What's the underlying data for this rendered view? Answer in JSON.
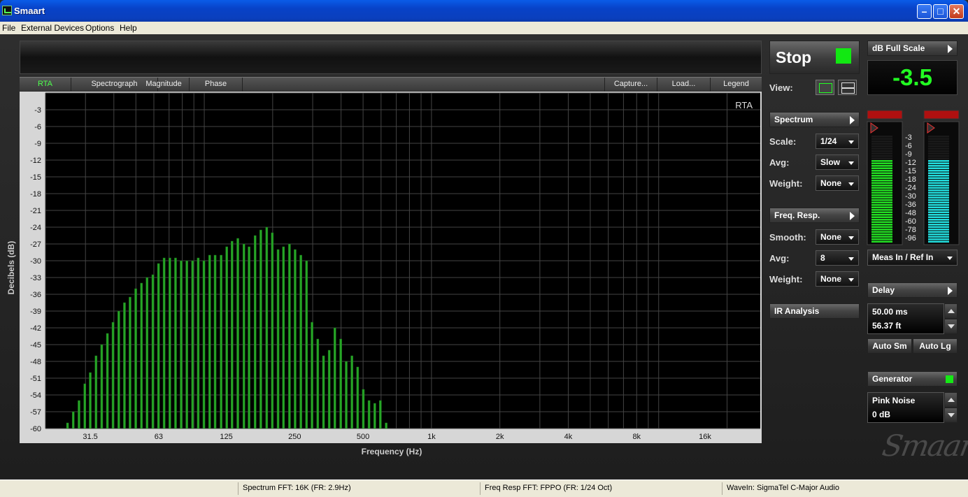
{
  "window": {
    "title": "Smaart"
  },
  "menu": [
    "File",
    "External Devices",
    "Options",
    "Help"
  ],
  "tabs": {
    "left": [
      "RTA",
      "Spectrograph",
      "Magnitude",
      "Phase"
    ],
    "right": [
      "Capture...",
      "Load...",
      "Legend"
    ],
    "active": "RTA"
  },
  "chart_data": {
    "type": "bar",
    "title": "RTA",
    "xlabel": "Frequency (Hz)",
    "ylabel": "Decibels (dB)",
    "x_scale": "log",
    "xlim": [
      20,
      28000
    ],
    "ylim": [
      -60,
      0
    ],
    "grid": true,
    "x_ticks": [
      "31.5",
      "63",
      "125",
      "250",
      "500",
      "1k",
      "2k",
      "4k",
      "8k",
      "16k"
    ],
    "y_ticks": [
      "-3",
      "-6",
      "-9",
      "-12",
      "-15",
      "-18",
      "-21",
      "-24",
      "-27",
      "-30",
      "-33",
      "-36",
      "-39",
      "-42",
      "-45",
      "-48",
      "-51",
      "-54",
      "-57",
      "-60"
    ],
    "bar_color": "#26a626",
    "series": [
      {
        "frequency_hz": [
          23.7,
          25.1,
          26.6,
          28.2,
          29.9,
          31.6,
          33.5,
          35.5,
          37.6,
          39.8,
          42.2,
          44.7,
          47.3,
          50.1,
          53.1,
          56.2,
          59.6,
          63.1,
          66.8,
          70.8,
          75.0,
          79.4,
          84.1,
          89.1,
          94.4,
          100,
          106,
          112,
          119,
          126,
          133,
          141,
          150,
          158,
          168,
          178,
          189,
          200,
          212,
          224,
          238,
          252,
          267,
          283,
          299,
          317,
          336,
          356,
          377,
          400,
          423,
          448,
          475,
          503,
          533,
          565,
          598,
          634
        ],
        "level_db": [
          -60,
          -59,
          -57,
          -55,
          -52,
          -50,
          -47,
          -45,
          -43,
          -41,
          -39,
          -37.5,
          -36.5,
          -35,
          -34,
          -33,
          -32.5,
          -30.5,
          -29.5,
          -29.5,
          -29.5,
          -30,
          -30,
          -30,
          -29.5,
          -30,
          -29,
          -29,
          -29,
          -27.5,
          -26.5,
          -26,
          -27,
          -27.5,
          -25.5,
          -24.5,
          -24,
          -25,
          -28,
          -27.5,
          -27,
          -28,
          -29,
          -30,
          -41,
          -44,
          -47,
          -46,
          -42,
          -44,
          -48,
          -47,
          -49,
          -53,
          -55,
          -55.5,
          -55,
          -59
        ]
      }
    ]
  },
  "controls": {
    "stop_label": "Stop",
    "view_label": "View:",
    "dbfs_header": "dB Full Scale",
    "dbfs_value": "-3.5",
    "spectrum_header": "Spectrum",
    "scale_label": "Scale:",
    "scale_value": "1/24",
    "avg_label": "Avg:",
    "avg_value": "Slow",
    "weight_label": "Weight:",
    "weight_value": "None",
    "freqresp_header": "Freq. Resp.",
    "smooth_label": "Smooth:",
    "smooth_value": "None",
    "fr_avg_label": "Avg:",
    "fr_avg_value": "8",
    "fr_weight_label": "Weight:",
    "fr_weight_value": "None",
    "ir_label": "IR Analysis",
    "meter_source": "Meas In / Ref In",
    "meter_scale": [
      "-3",
      "-6",
      "-9",
      "-12",
      "-15",
      "-18",
      "-24",
      "-30",
      "-36",
      "-48",
      "-60",
      "-78",
      "-96"
    ],
    "meter_left_level": 0.78,
    "meter_right_level": 0.78,
    "delay_header": "Delay",
    "delay_ms": "50.00 ms",
    "delay_ft": "56.37 ft",
    "auto_sm": "Auto Sm",
    "auto_lg": "Auto Lg",
    "generator_header": "Generator",
    "gen_signal": "Pink Noise",
    "gen_level": "0 dB",
    "watermark": "Smaart"
  },
  "status": [
    "Spectrum FFT: 16K (FR: 2.9Hz)",
    "Freq Resp FFT: FPPO (FR: 1/24 Oct)",
    "WaveIn: SigmaTel C-Major Audio"
  ],
  "colors": {
    "accent_green": "#22ff22",
    "title_blue": "#0a5ce8",
    "meter_green": "#22dd22",
    "meter_cyan": "#22dddd"
  }
}
